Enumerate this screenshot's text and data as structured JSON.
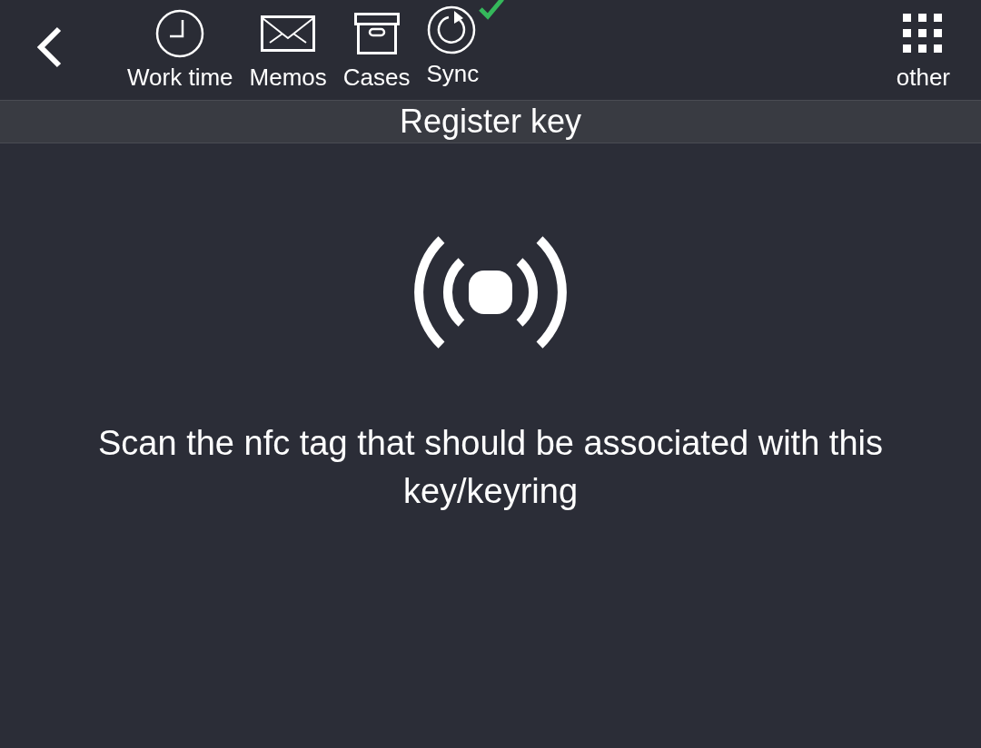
{
  "toolbar": {
    "items": [
      {
        "kind": "clock",
        "label": "Work time"
      },
      {
        "kind": "mail",
        "label": "Memos"
      },
      {
        "kind": "box",
        "label": "Cases"
      },
      {
        "kind": "sync",
        "label": "Sync",
        "synced": true
      }
    ],
    "other": {
      "kind": "grid",
      "label": "other"
    }
  },
  "title": "Register key",
  "message": "Scan the nfc tag that should be associated with this key/keyring"
}
